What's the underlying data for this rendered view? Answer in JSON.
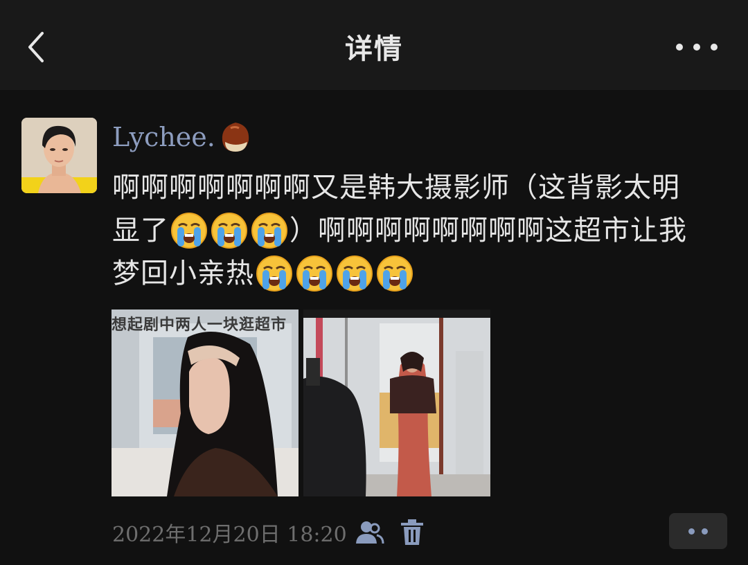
{
  "header": {
    "title": "详情",
    "back_icon": "chevron-left-icon",
    "more_icon": "more-dots-icon"
  },
  "post": {
    "author": "Lychee.",
    "author_emoji": "chestnut-emoji",
    "text_segments": [
      "啊啊啊啊啊啊啊又是韩大摄影师（这背影太明",
      "显了",
      "）啊啊啊啊啊啊啊啊这超市让我",
      "梦回小亲热"
    ],
    "emoji": "loudly-crying-face",
    "photos": [
      {
        "caption": "想起剧中两人一块逛超市",
        "description": "woman-in-supermarket"
      },
      {
        "caption": "",
        "description": "woman-at-store-entrance"
      }
    ],
    "timestamp": "2022年12月20日  18:20",
    "visibility_icon": "friends-icon",
    "delete_icon": "trash-icon",
    "action_icon": "comment-like-dots-icon"
  },
  "colors": {
    "background": "#111111",
    "header_background": "#191919",
    "author_link": "#8d9dbf",
    "text": "#e6e6e6",
    "timestamp": "#6e6e6e"
  }
}
